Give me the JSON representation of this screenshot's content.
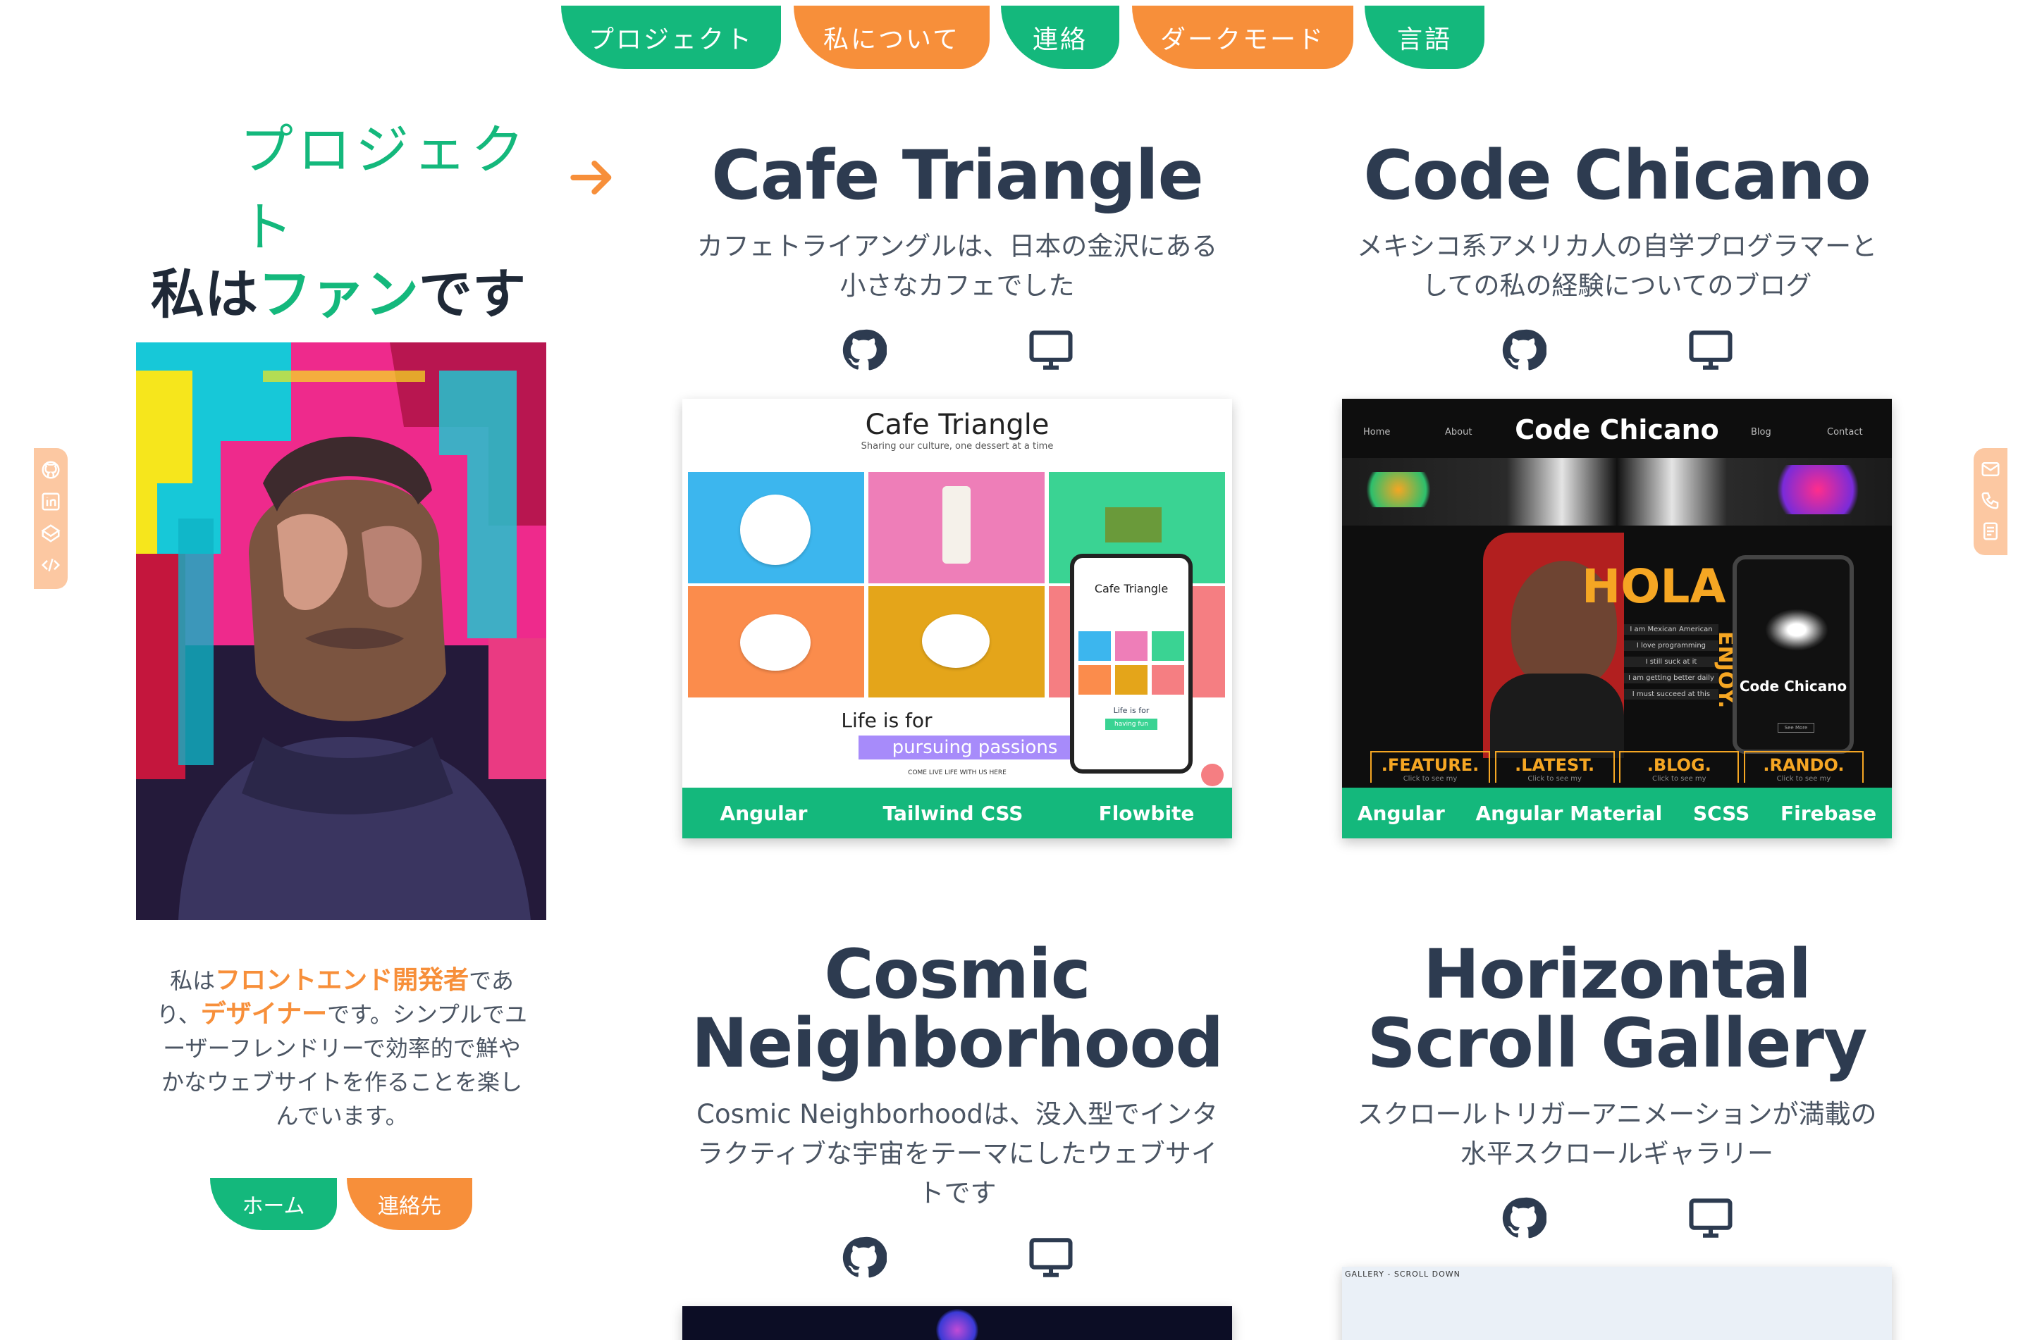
{
  "nav": {
    "items": [
      {
        "label": "プロジェクト",
        "color": "#14b87c"
      },
      {
        "label": "私について",
        "color": "#f78f3a"
      },
      {
        "label": "連絡",
        "color": "#14b87c"
      },
      {
        "label": "ダークモード",
        "color": "#f78f3a"
      },
      {
        "label": "言語",
        "color": "#14b87c"
      }
    ]
  },
  "left_rail": {
    "icons": [
      "github-icon",
      "linkedin-icon",
      "codepen-icon",
      "code-icon"
    ]
  },
  "right_rail": {
    "icons": [
      "mail-icon",
      "phone-icon",
      "resume-icon"
    ]
  },
  "sidebar": {
    "projects_link": "プロジェクト",
    "intro_prefix": "私は",
    "intro_highlight": "ファン",
    "intro_suffix": "です",
    "bio": {
      "p1": "私は",
      "h1": "フロントエンド開発者",
      "p2": "であり、",
      "h2": "デザイナー",
      "p3": "です。シンプルでユーザーフレンドリーで効率的で鮮やかなウェブサイトを作ることを楽しんでいます。"
    },
    "home_button": "ホーム",
    "contact_button": "連絡先"
  },
  "projects": [
    {
      "title": "Cafe Triangle",
      "description": "カフェトライアングルは、日本の金沢にある小さなカフェでした",
      "tech": [
        "Angular",
        "Tailwind CSS",
        "Flowbite"
      ],
      "preview": {
        "title": "Cafe Triangle",
        "subtitle": "Sharing our culture, one dessert at a time",
        "tagline_1": "Life is for",
        "tagline_2": "pursuing passions",
        "footer": "COME LIVE LIFE WITH US HERE",
        "phone_title": "Cafe Triangle",
        "phone_tagline": "Life is for",
        "phone_badge": "having fun"
      }
    },
    {
      "title": "Code Chicano",
      "description": "メキシコ系アメリカ人の自学プログラマーとしての私の経験についてのブログ",
      "tech": [
        "Angular",
        "Angular Material",
        "SCSS",
        "Firebase"
      ],
      "preview": {
        "brand": "Code Chicano",
        "nav": [
          "Home",
          "About",
          "Blog",
          "Contact"
        ],
        "hero": "HOLA",
        "side": "ENJOY.",
        "bullets": [
          "I am Mexican American",
          "I love programming",
          "I still suck at it",
          "I am getting better daily",
          "I must succeed at this"
        ],
        "sections": [
          ".FEATURE.",
          ".LATEST.",
          ".BLOG.",
          ".RANDO."
        ],
        "section_caption": "Click to see my",
        "phone_brand": "Code Chicano",
        "phone_button": "See More"
      }
    },
    {
      "title": "Cosmic Neighborhood",
      "description": "Cosmic Neighborhoodは、没入型でインタラクティブな宇宙をテーマにしたウェブサイトです",
      "tech": []
    },
    {
      "title": "Horizontal Scroll Gallery",
      "description": "スクロールトリガーアニメーションが満載の水平スクロールギャラリー",
      "tech": [],
      "preview": {
        "caption": "GALLERY - SCROLL DOWN"
      }
    }
  ]
}
